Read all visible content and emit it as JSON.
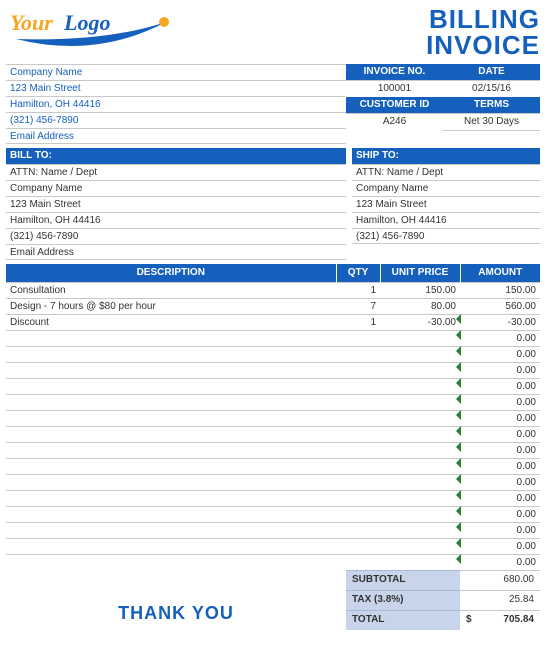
{
  "title_line1": "BILLING",
  "title_line2": "INVOICE",
  "logo": {
    "your": "Your",
    "logo": "Logo"
  },
  "company": {
    "name": "Company Name",
    "street": "123 Main Street",
    "city": "Hamilton, OH  44416",
    "phone": "(321) 456-7890",
    "email": "Email Address"
  },
  "meta": {
    "invoice_no_label": "INVOICE NO.",
    "date_label": "DATE",
    "invoice_no": "100001",
    "date": "02/15/16",
    "customer_id_label": "CUSTOMER ID",
    "terms_label": "TERMS",
    "customer_id": "A246",
    "terms": "Net 30 Days"
  },
  "billto": {
    "label": "BILL TO:",
    "attn": "ATTN: Name / Dept",
    "company": "Company Name",
    "street": "123 Main Street",
    "city": "Hamilton, OH  44416",
    "phone": "(321) 456-7890",
    "email": "Email Address"
  },
  "shipto": {
    "label": "SHIP TO:",
    "attn": "ATTN: Name / Dept",
    "company": "Company Name",
    "street": "123 Main Street",
    "city": "Hamilton, OH  44416",
    "phone": "(321) 456-7890"
  },
  "cols": {
    "desc": "DESCRIPTION",
    "qty": "QTY",
    "price": "UNIT PRICE",
    "amount": "AMOUNT"
  },
  "items": [
    {
      "desc": "Consultation",
      "qty": "1",
      "price": "150.00",
      "amount": "150.00"
    },
    {
      "desc": "Design - 7 hours @ $80 per hour",
      "qty": "7",
      "price": "80.00",
      "amount": "560.00"
    },
    {
      "desc": "Discount",
      "qty": "1",
      "price": "-30.00",
      "amount": "-30.00"
    },
    {
      "desc": "",
      "qty": "",
      "price": "",
      "amount": "0.00"
    },
    {
      "desc": "",
      "qty": "",
      "price": "",
      "amount": "0.00"
    },
    {
      "desc": "",
      "qty": "",
      "price": "",
      "amount": "0.00"
    },
    {
      "desc": "",
      "qty": "",
      "price": "",
      "amount": "0.00"
    },
    {
      "desc": "",
      "qty": "",
      "price": "",
      "amount": "0.00"
    },
    {
      "desc": "",
      "qty": "",
      "price": "",
      "amount": "0.00"
    },
    {
      "desc": "",
      "qty": "",
      "price": "",
      "amount": "0.00"
    },
    {
      "desc": "",
      "qty": "",
      "price": "",
      "amount": "0.00"
    },
    {
      "desc": "",
      "qty": "",
      "price": "",
      "amount": "0.00"
    },
    {
      "desc": "",
      "qty": "",
      "price": "",
      "amount": "0.00"
    },
    {
      "desc": "",
      "qty": "",
      "price": "",
      "amount": "0.00"
    },
    {
      "desc": "",
      "qty": "",
      "price": "",
      "amount": "0.00"
    },
    {
      "desc": "",
      "qty": "",
      "price": "",
      "amount": "0.00"
    },
    {
      "desc": "",
      "qty": "",
      "price": "",
      "amount": "0.00"
    },
    {
      "desc": "",
      "qty": "",
      "price": "",
      "amount": "0.00"
    }
  ],
  "totals": {
    "subtotal_label": "SUBTOTAL",
    "subtotal": "680.00",
    "tax_label": "TAX (3.8%)",
    "tax": "25.84",
    "total_label": "TOTAL",
    "currency": "$",
    "total": "705.84"
  },
  "thanks": "THANK YOU"
}
